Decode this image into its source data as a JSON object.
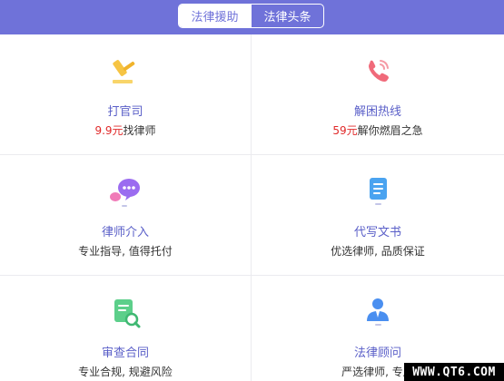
{
  "tabs": [
    {
      "label": "法律援助",
      "active": true
    },
    {
      "label": "法律头条",
      "active": false
    }
  ],
  "accent_color": "#6f72d9",
  "highlight_color": "#e02828",
  "services": [
    {
      "title": "打官司",
      "desc_highlight": "9.9元",
      "desc": "找律师",
      "icon": "gavel-icon"
    },
    {
      "title": "解困热线",
      "desc_highlight": "59元",
      "desc": "解你燃眉之急",
      "icon": "phone-icon"
    },
    {
      "title": "律师介入",
      "desc_highlight": "",
      "desc": "专业指导, 值得托付",
      "icon": "chat-bubbles-icon"
    },
    {
      "title": "代写文书",
      "desc_highlight": "",
      "desc": "优选律师, 品质保证",
      "icon": "document-icon"
    },
    {
      "title": "审查合同",
      "desc_highlight": "",
      "desc": "专业合规, 规避风险",
      "icon": "contract-review-icon"
    },
    {
      "title": "法律顾问",
      "desc_highlight": "",
      "desc": "严选律师, 专属",
      "icon": "advisor-icon"
    }
  ],
  "watermark": "WWW.QT6.COM"
}
